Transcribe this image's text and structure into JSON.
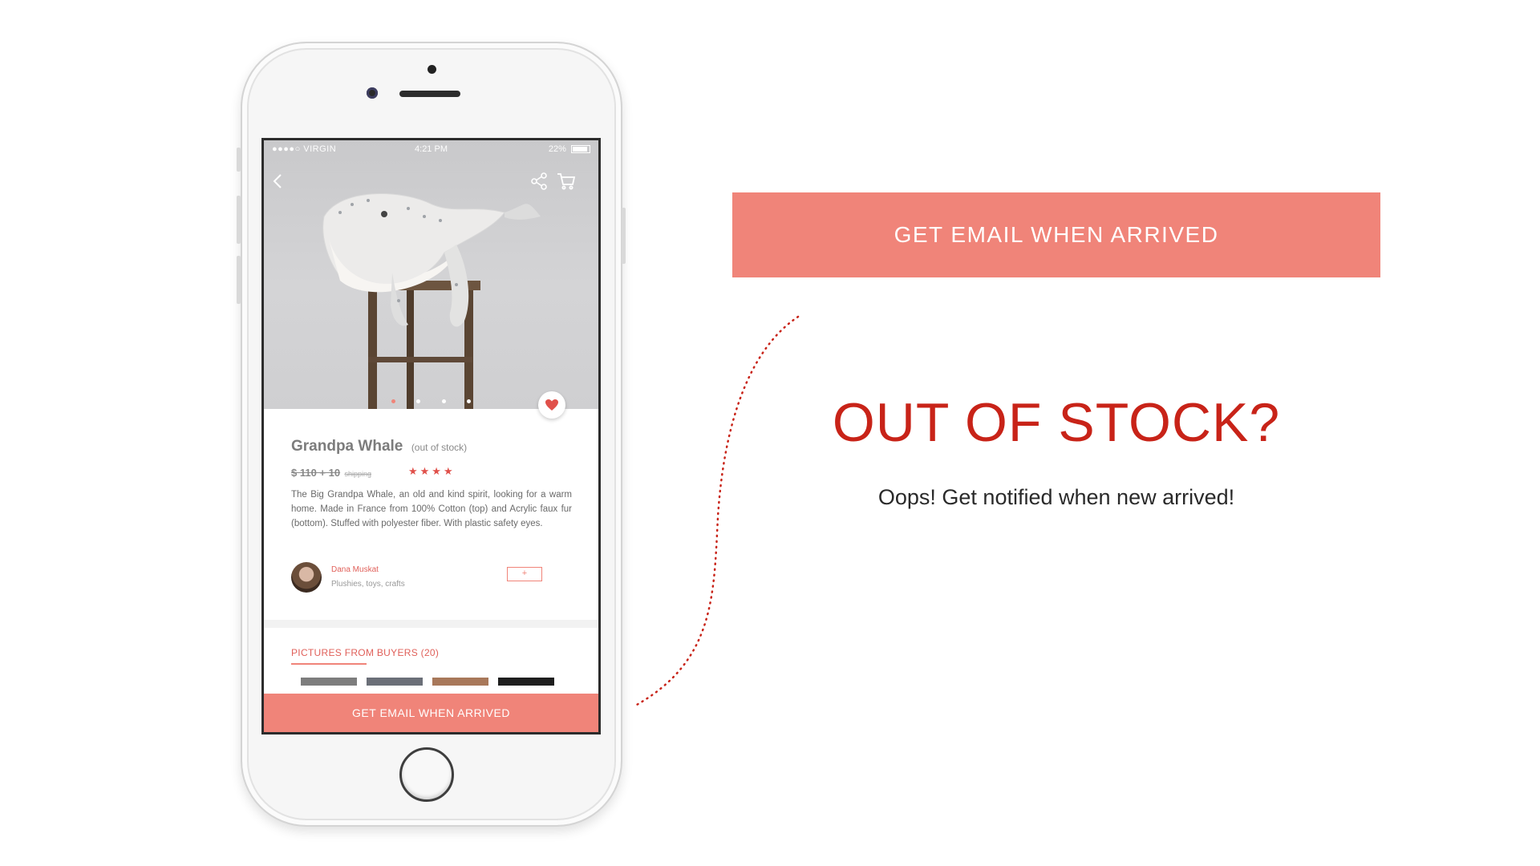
{
  "phone": {
    "status_bar": {
      "carrier": "●●●●○ VIRGIN",
      "time": "4:21 PM",
      "battery": "22%"
    },
    "product": {
      "name": "Grandpa Whale",
      "stock_note": "(out of stock)",
      "price": "$ 110 + 10",
      "shipping": "shipping",
      "rating": 4,
      "rating_display": "★★★★",
      "description": "The Big Grandpa Whale, an old and kind spirit, looking for a warm home. Made in France from 100% Cotton (top) and Acrylic faux fur (bottom). Stuffed with polyester fiber. With plastic safety eyes."
    },
    "carousel": {
      "count": 4,
      "active": 0
    },
    "seller": {
      "name": "Dana Muskat",
      "tags": "Plushies, toys, crafts",
      "follow_label": "+"
    },
    "buyers_section": {
      "title": "PICTURES FROM BUYERS (20)"
    },
    "cta_label": "GET EMAIL WHEN ARRIVED"
  },
  "promo": {
    "cta_label": "GET EMAIL WHEN ARRIVED",
    "headline": "OUT OF STOCK?",
    "subhead": "Oops! Get notified when new arrived!"
  },
  "colors": {
    "accent": "#f08479",
    "headline": "#c82318",
    "star": "#e0504a"
  },
  "icons": [
    "back-arrow-icon",
    "share-icon",
    "cart-icon",
    "heart-icon",
    "wifi-icon",
    "battery-icon"
  ]
}
